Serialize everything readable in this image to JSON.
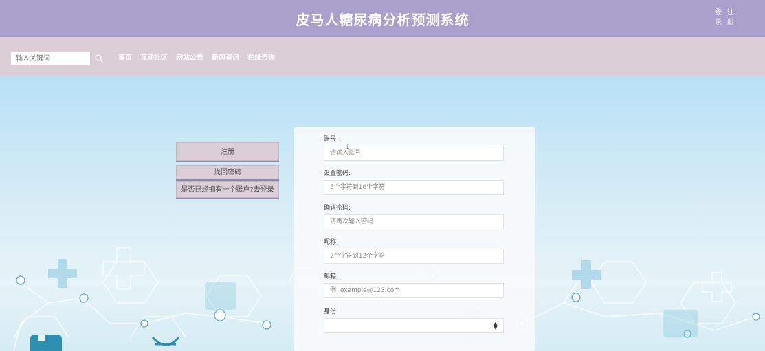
{
  "header": {
    "title": "皮马人糖尿病分析预测系统",
    "login_label": "登录",
    "register_label": "注册"
  },
  "navbar": {
    "search_placeholder": "输入关键词",
    "items": [
      {
        "label": "首页"
      },
      {
        "label": "互动社区"
      },
      {
        "label": "网站公告"
      },
      {
        "label": "新闻资讯"
      },
      {
        "label": "在线咨询"
      }
    ]
  },
  "side_buttons": {
    "register": "注册",
    "find_password": "找回密码",
    "go_login": "是否已经拥有一个账户?去登录"
  },
  "form": {
    "account": {
      "label": "账号:",
      "placeholder": "请输入账号"
    },
    "password": {
      "label": "设置密码:",
      "placeholder": "5个字符到16个字符"
    },
    "confirm_password": {
      "label": "确认密码:",
      "placeholder": "请再次输入密码"
    },
    "nickname": {
      "label": "昵称:",
      "placeholder": "2个字符到12个字符"
    },
    "email": {
      "label": "邮箱:",
      "placeholder": "例: example@123.com"
    },
    "identity": {
      "label": "身份:",
      "value": ""
    }
  },
  "colors": {
    "header_bg": "#a9a0cc",
    "navbar_bg": "#dcced7",
    "button_bg": "#dcced8",
    "panel_bg": "#f7fafc"
  }
}
